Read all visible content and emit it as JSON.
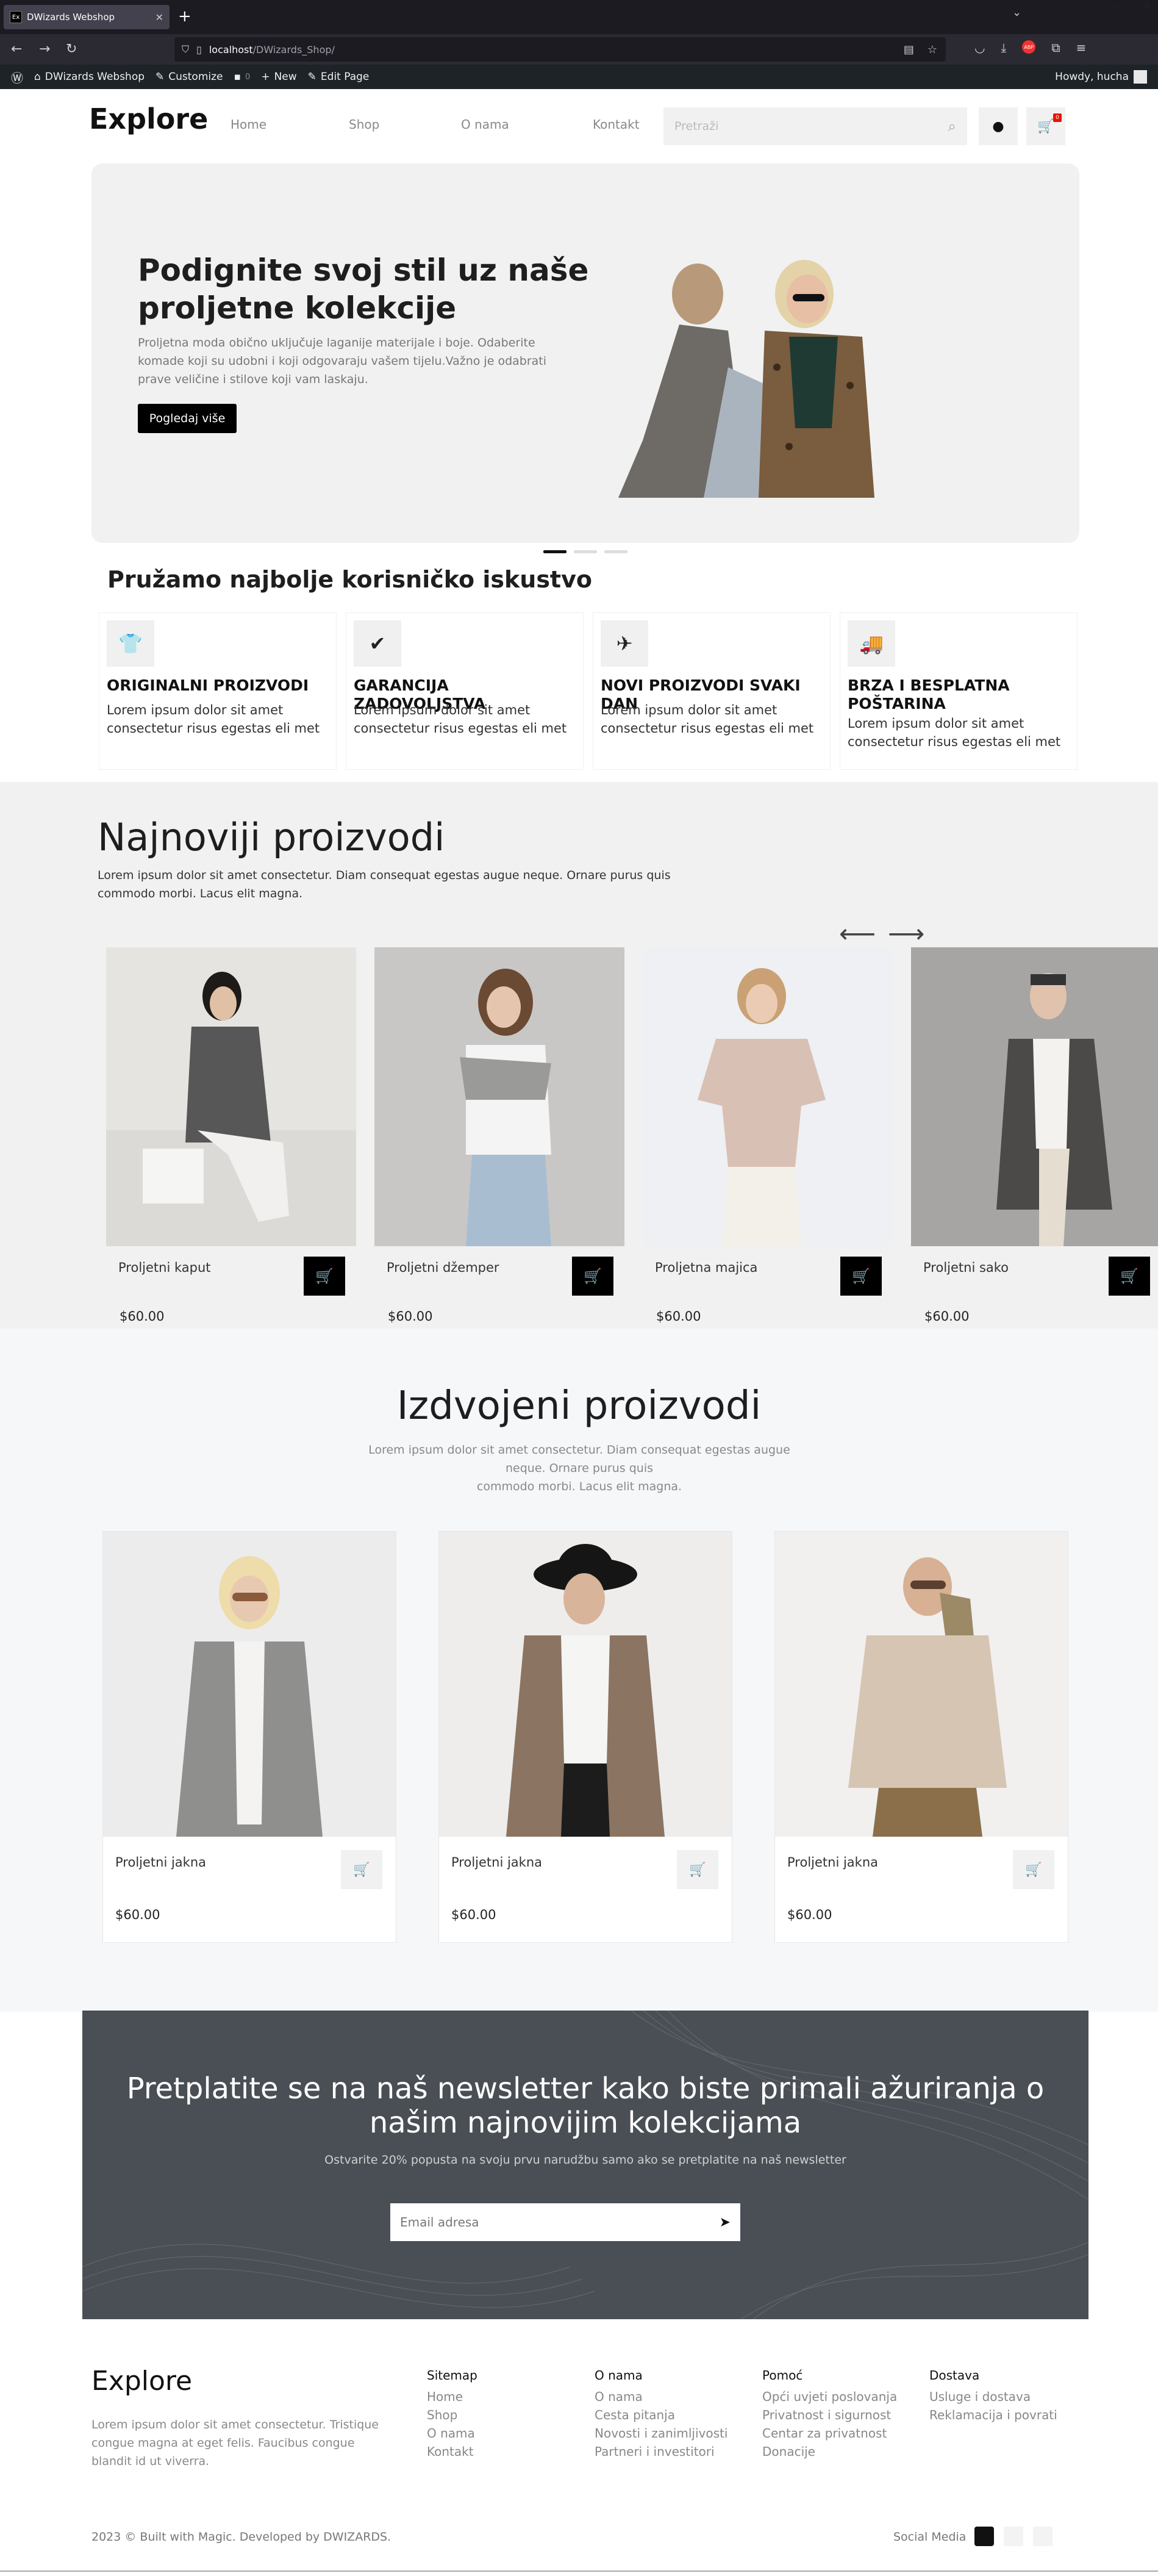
{
  "browser": {
    "tab_title": "DWizards Webshop",
    "tab_favicon": "Ex",
    "url_host": "localhost",
    "url_path": "/DWizards_Shop/"
  },
  "wp_admin_bar": {
    "site_name": "DWizards Webshop",
    "customize": "Customize",
    "comments": "0",
    "new": "New",
    "edit_page": "Edit Page",
    "howdy": "Howdy, hucha"
  },
  "header": {
    "logo": "Explore",
    "nav": [
      "Home",
      "Shop",
      "O nama",
      "Kontakt"
    ],
    "search_placeholder": "Pretraži",
    "cart_count": "0"
  },
  "hero": {
    "title": "Podignite svoj stil uz naše proljetne kolekcije",
    "text": "Proljetna moda obično uključuje laganije materijale i boje. Odaberite komade koji su udobni i koji odgovaraju vašem tijelu.Važno je odabrati prave veličine i stilove koji vam laskaju.",
    "button": "Pogledaj više"
  },
  "features": {
    "title": "Pružamo najbolje korisničko iskustvo",
    "items": [
      {
        "icon": "tshirt-icon",
        "title": "ORIGINALNI PROIZVODI",
        "text": "Lorem ipsum dolor sit amet consectetur risus egestas eli met"
      },
      {
        "icon": "badge-check-icon",
        "title": "GARANCIJA ZADOVOLJSTVA",
        "text": "Lorem ipsum dolor sit amet consectetur risus egestas eli met"
      },
      {
        "icon": "plane-icon",
        "title": "NOVI PROIZVODI SVAKI DAN",
        "text": "Lorem ipsum dolor sit amet consectetur risus egestas eli met"
      },
      {
        "icon": "truck-icon",
        "title": "BRZA I BESPLATNA POŠTARINA",
        "text": "Lorem ipsum dolor sit amet consectetur risus egestas eli met"
      }
    ]
  },
  "newest": {
    "title": "Najnoviji proizvodi",
    "text": "Lorem ipsum dolor sit amet consectetur. Diam consequat egestas augue neque. Ornare purus quis commodo morbi. Lacus elit magna.",
    "products": [
      {
        "name": "Proljetni kaput",
        "price": "$60.00"
      },
      {
        "name": "Proljetni džemper",
        "price": "$60.00"
      },
      {
        "name": "Proljetna majica",
        "price": "$60.00"
      },
      {
        "name": "Proljetni sako",
        "price": "$60.00"
      }
    ]
  },
  "featured": {
    "title": "Izdvojeni proizvodi",
    "text_line1": "Lorem ipsum dolor sit amet consectetur. Diam consequat egestas augue neque. Ornare purus quis",
    "text_line2": "commodo morbi. Lacus elit magna.",
    "products": [
      {
        "name": "Proljetni jakna",
        "price": "$60.00"
      },
      {
        "name": "Proljetni jakna",
        "price": "$60.00"
      },
      {
        "name": "Proljetni jakna",
        "price": "$60.00"
      }
    ]
  },
  "newsletter": {
    "title": "Pretplatite se na naš newsletter kako biste primali ažuriranja o našim najnovijim kolekcijama",
    "text": "Ostvarite 20% popusta na svoju prvu narudžbu samo ako se pretplatite na naš newsletter",
    "placeholder": "Email adresa"
  },
  "footer": {
    "logo": "Explore",
    "text": "Lorem ipsum dolor sit amet consectetur. Tristique congue magna at eget felis. Faucibus congue blandit id ut viverra.",
    "columns": [
      {
        "title": "Sitemap",
        "links": [
          "Home",
          "Shop",
          "O nama",
          "Kontakt"
        ]
      },
      {
        "title": "O nama",
        "links": [
          "O nama",
          "Cesta pitanja",
          "Novosti i zanimljivosti",
          "Partneri i investitori"
        ]
      },
      {
        "title": "Pomoć",
        "links": [
          "Opći uvjeti poslovanja",
          "Privatnost i sigurnost",
          "Centar za privatnost",
          "Donacije"
        ]
      },
      {
        "title": "Dostava",
        "links": [
          "Usluge i dostava",
          "Reklamacija i povrati"
        ]
      }
    ],
    "copyright": "2023 © Built with Magic. Developed by DWIZARDS.",
    "social_label": "Social Media"
  },
  "colors": {
    "accent": "#000000",
    "badge": "#ee1111",
    "hero_bg": "#f1f1f1",
    "newsletter_bg": "#4a4f55"
  }
}
